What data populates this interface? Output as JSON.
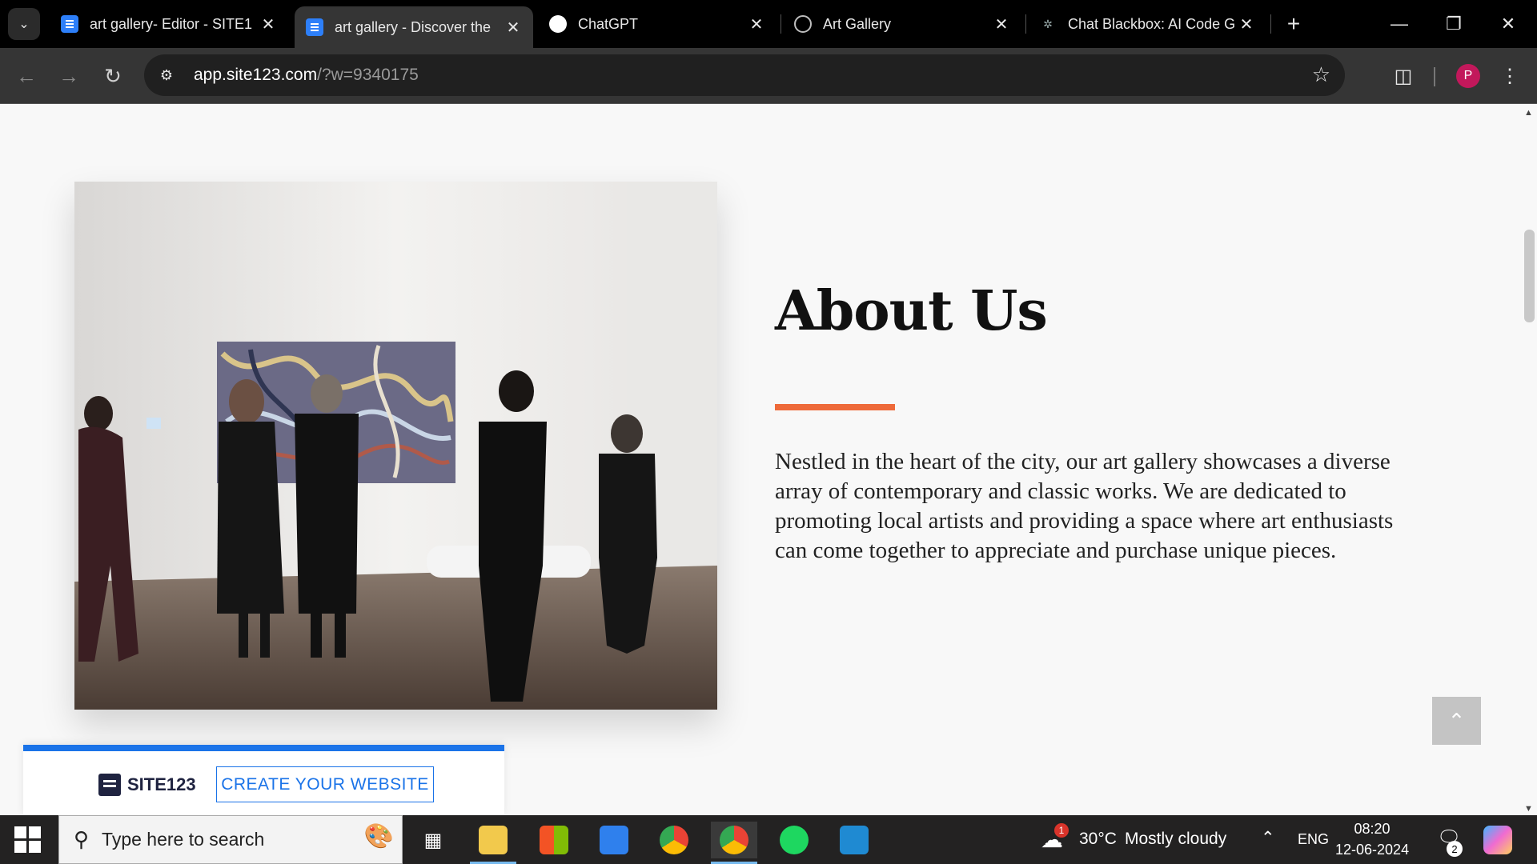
{
  "browser": {
    "tabs": [
      {
        "title": "art gallery- Editor - SITE1",
        "favicon": "doc-icon",
        "active": false
      },
      {
        "title": "art gallery - Discover the",
        "favicon": "doc-icon",
        "active": true
      },
      {
        "title": "ChatGPT",
        "favicon": "chatgpt-icon",
        "active": false
      },
      {
        "title": "Art Gallery",
        "favicon": "globe-icon",
        "active": false
      },
      {
        "title": "Chat Blackbox: AI Code G",
        "favicon": "blackbox-icon",
        "active": false
      }
    ],
    "url_host": "app.site123.com",
    "url_path": "/?w=9340175",
    "profile_initial": "P"
  },
  "page": {
    "about": {
      "title": "About Us",
      "body": "Nestled in the heart of the city, our art gallery showcases a diverse array of contemporary and classic works. We are dedicated to promoting local artists and providing a space where art enthusiasts can come together to appreciate and purchase unique pieces."
    },
    "accent_color": "#ee6a3a",
    "promo": {
      "brand": "SITE123",
      "cta_label": "CREATE YOUR WEBSITE",
      "brand_color": "#1a73e8"
    }
  },
  "taskbar": {
    "search_placeholder": "Type here to search",
    "weather": {
      "temp": "30°C",
      "condition": "Mostly cloudy",
      "alert_count": "1"
    },
    "language": "ENG",
    "time": "08:20",
    "date": "12-06-2024",
    "notification_count": "2"
  }
}
